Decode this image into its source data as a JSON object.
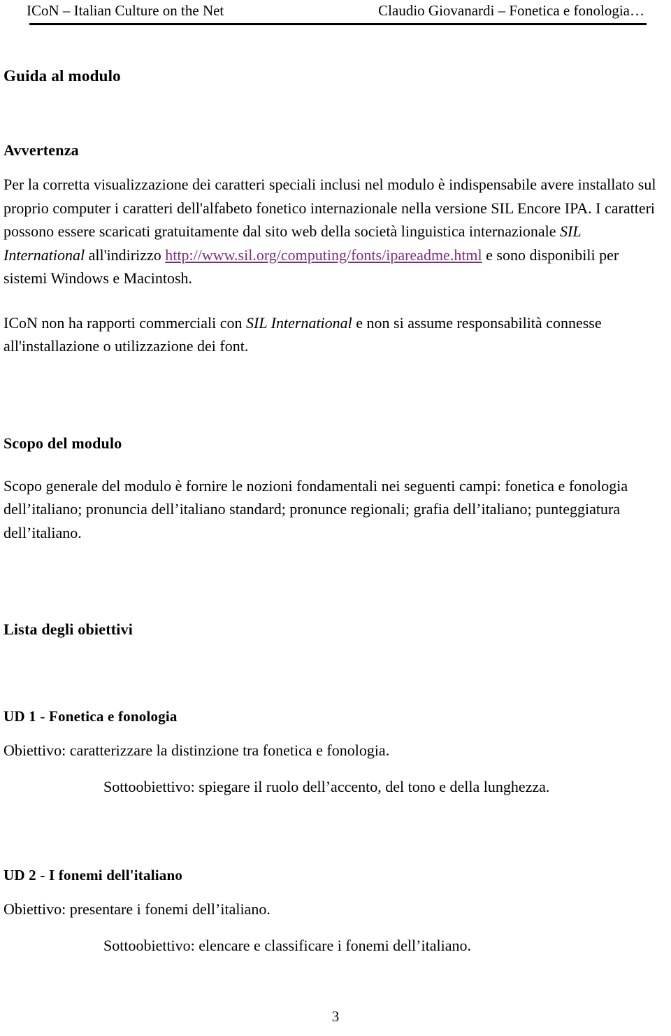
{
  "header": {
    "left": "ICoN – Italian Culture on the Net",
    "right": "Claudio Giovanardi – Fonetica e fonologia…"
  },
  "title": "Guida al modulo",
  "sections": {
    "avvertenza": {
      "heading": "Avvertenza",
      "paragraph1": {
        "part1": "Per la corretta visualizzazione dei caratteri speciali inclusi nel modulo è indispensabile avere installato sul proprio computer i caratteri dell'alfabeto fonetico internazionale nella versione SIL Encore IPA. I caratteri possono essere scaricati gratuitamente dal sito web della società linguistica internazionale ",
        "italic1": "SIL International",
        "part2": " all'indirizzo ",
        "link": "http://www.sil.org/computing/fonts/ipareadme.html",
        "part3": " e sono disponibili per sistemi Windows e Macintosh."
      },
      "paragraph2": {
        "part1": "ICoN non ha rapporti commerciali con ",
        "italic1": "SIL International",
        "part2": " e non si assume responsabilità connesse all'installazione o utilizzazione dei font."
      }
    },
    "scopo": {
      "heading": "Scopo del modulo",
      "paragraph": "Scopo generale del modulo è fornire le nozioni fondamentali nei seguenti campi: fonetica e fonologia dell’italiano; pronuncia dell’italiano standard; pronunce regionali; grafia dell’italiano; punteggiatura dell’italiano."
    },
    "lista": {
      "heading": "Lista degli obiettivi",
      "units": [
        {
          "heading": "UD 1 - Fonetica e fonologia",
          "objective": "Obiettivo: caratterizzare la distinzione tra fonetica e fonologia.",
          "subobjective": "Sottoobiettivo: spiegare il ruolo dell’accento, del tono e della lunghezza."
        },
        {
          "heading": "UD 2 - I fonemi dell'italiano",
          "objective": "Obiettivo: presentare i fonemi dell’italiano.",
          "subobjective": "Sottoobiettivo: elencare e classificare i fonemi dell’italiano."
        }
      ]
    }
  },
  "footer": {
    "page_number": "3"
  },
  "colors": {
    "link": "#7b2f7b",
    "text": "#000000",
    "background": "#ffffff"
  }
}
